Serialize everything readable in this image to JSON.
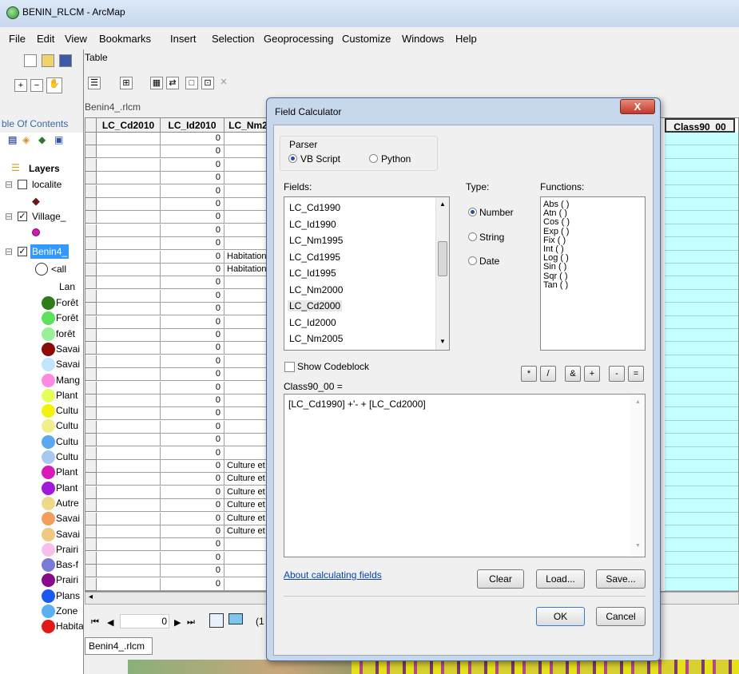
{
  "window": {
    "title": "BENIN_RLCM - ArcMap"
  },
  "menu": [
    "File",
    "Edit",
    "View",
    "Bookmarks",
    "Insert",
    "Selection",
    "Geoprocessing",
    "Customize",
    "Windows",
    "Help"
  ],
  "toc": {
    "header": "ble Of Contents",
    "layers_label": "Layers",
    "items": [
      {
        "label": "localite",
        "checked": false
      },
      {
        "label": "Village_",
        "checked": true
      },
      {
        "label": "Benin4_",
        "checked": true
      }
    ],
    "all_label": "<all",
    "lan_label": "Lan",
    "legend": [
      {
        "label": "Forêt",
        "color": "#2e7d1a"
      },
      {
        "label": "Forêt",
        "color": "#5ee05e"
      },
      {
        "label": "forêt",
        "color": "#9af09a"
      },
      {
        "label": "Savai",
        "color": "#8b0a0a"
      },
      {
        "label": "Savai",
        "color": "#bfe6ff"
      },
      {
        "label": "Mang",
        "color": "#ff8ae0"
      },
      {
        "label": "Plant",
        "color": "#e6ff5a"
      },
      {
        "label": "Cultu",
        "color": "#f2f20a"
      },
      {
        "label": "Cultu",
        "color": "#f2ef8a"
      },
      {
        "label": "Cultu",
        "color": "#5aa8f0"
      },
      {
        "label": "Cultu",
        "color": "#a8c8f0"
      },
      {
        "label": "Plant",
        "color": "#d81ab8"
      },
      {
        "label": "Plant",
        "color": "#a01ad8"
      },
      {
        "label": "Autre",
        "color": "#f0d88a"
      },
      {
        "label": "Savai",
        "color": "#f0a05a"
      },
      {
        "label": "Savai",
        "color": "#f0c880"
      },
      {
        "label": "Prairi",
        "color": "#f8c0e8"
      },
      {
        "label": "Bas-f",
        "color": "#7a7ad8"
      },
      {
        "label": "Prairi",
        "color": "#8a0a8a"
      },
      {
        "label": "Plans",
        "color": "#1a5af0"
      },
      {
        "label": "Zone",
        "color": "#5ab0f0"
      },
      {
        "label": "Habitation",
        "color": "#e01a1a"
      }
    ]
  },
  "table": {
    "title": "Table",
    "tab_name": "Benin4_.rlcm",
    "columns": [
      "LC_Cd2010",
      "LC_Id2010",
      "LC_Nm2",
      "Class90_00"
    ],
    "rows_id": [
      "0",
      "0",
      "0",
      "0",
      "0",
      "0",
      "0",
      "0",
      "0",
      "0",
      "0",
      "0",
      "0",
      "0",
      "0",
      "0",
      "0",
      "0",
      "0",
      "0",
      "0",
      "0",
      "0",
      "0",
      "0",
      "0",
      "0",
      "0",
      "0",
      "0",
      "0",
      "0",
      "0",
      "0",
      "0"
    ],
    "rows_nm": [
      "",
      "",
      "",
      "",
      "",
      "",
      "",
      "",
      "",
      "Habitation",
      "Habitation",
      "",
      "",
      "",
      "",
      "",
      "",
      "",
      "",
      "",
      "",
      "",
      "",
      "",
      "",
      "Culture et",
      "Culture et",
      "Culture et",
      "Culture et",
      "Culture et",
      "Culture et",
      "",
      "",
      "",
      ""
    ],
    "nav_value": "0",
    "nav_suffix": "(1"
  },
  "dialog": {
    "title": "Field Calculator",
    "close": "X",
    "parser_label": "Parser",
    "parser_options": [
      "VB Script",
      "Python"
    ],
    "fields_label": "Fields:",
    "fields": [
      "LC_Cd1990",
      "LC_Id1990",
      "LC_Nm1995",
      "LC_Cd1995",
      "LC_Id1995",
      "LC_Nm2000",
      "LC_Cd2000",
      "LC_Id2000",
      "LC_Nm2005"
    ],
    "type_label": "Type:",
    "types": [
      "Number",
      "String",
      "Date"
    ],
    "functions_label": "Functions:",
    "functions": [
      "Abs ( )",
      "Atn ( )",
      "Cos ( )",
      "Exp ( )",
      "Fix ( )",
      "Int ( )",
      "Log ( )",
      "Sin ( )",
      "Sqr ( )",
      "Tan ( )"
    ],
    "show_codeblock": "Show Codeblock",
    "operators": [
      "*",
      "/",
      "&",
      "+",
      "-",
      "="
    ],
    "expr_label": "Class90_00 =",
    "expression": "[LC_Cd1990] +'- + [LC_Cd2000]",
    "about_link": "About calculating fields",
    "buttons": {
      "clear": "Clear",
      "load": "Load...",
      "save": "Save...",
      "ok": "OK",
      "cancel": "Cancel"
    }
  }
}
